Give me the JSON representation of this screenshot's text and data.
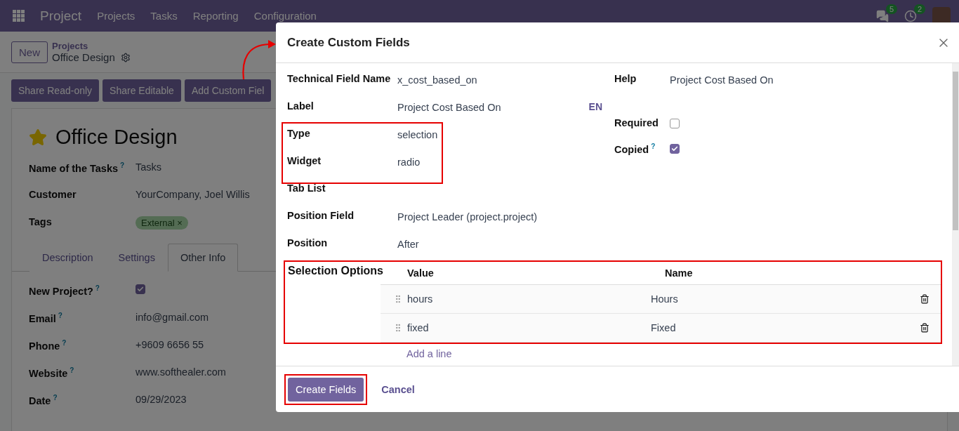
{
  "navbar": {
    "app_name": "Project",
    "menu": [
      "Projects",
      "Tasks",
      "Reporting",
      "Configuration"
    ],
    "messages_count": "5",
    "activities_count": "2"
  },
  "control_panel": {
    "new_button": "New",
    "breadcrumb_parent": "Projects",
    "breadcrumb_current": "Office Design"
  },
  "action_buttons": [
    "Share Read-only",
    "Share Editable",
    "Add Custom Fiel"
  ],
  "record": {
    "title": "Office Design",
    "starred": true,
    "fields": [
      {
        "label": "Name of the Tasks",
        "help_mark": "?",
        "value": "Tasks"
      },
      {
        "label": "Customer",
        "value": "YourCompany, Joel Willis"
      }
    ],
    "tags_label": "Tags",
    "tags": [
      {
        "label": "External",
        "remove": "×"
      }
    ],
    "tabs": [
      {
        "label": "Description",
        "selected": false
      },
      {
        "label": "Settings",
        "selected": false
      },
      {
        "label": "Other Info",
        "selected": true
      }
    ],
    "other_info": [
      {
        "kind": "checkbox",
        "label": "New Project?",
        "help_mark": "?",
        "checked": true
      },
      {
        "kind": "text",
        "label": "Email",
        "help_mark": "?",
        "value": "info@gmail.com"
      },
      {
        "kind": "text",
        "label": "Phone",
        "help_mark": "?",
        "value": "+9609 6656 55"
      },
      {
        "kind": "text",
        "label": "Website",
        "help_mark": "?",
        "value": "www.softhealer.com"
      },
      {
        "kind": "text",
        "label": "Date",
        "help_mark": "?",
        "value": "09/29/2023"
      }
    ]
  },
  "dialog": {
    "title": "Create Custom Fields",
    "fields": [
      {
        "label": "Technical Field Name",
        "value": "x_cost_based_on",
        "highlighted": false
      },
      {
        "label": "Label",
        "value": "Project Cost Based On",
        "language": "EN",
        "highlighted": false
      },
      {
        "label": "Type",
        "value": "selection",
        "highlighted": true
      },
      {
        "label": "Widget",
        "value": "radio",
        "highlighted": true
      },
      {
        "label": "Tab List",
        "highlighted": false
      },
      {
        "label": "Position Field",
        "value": "Project Leader (project.project)",
        "highlighted": false
      },
      {
        "label": "Position",
        "value": "After",
        "highlighted": false
      }
    ],
    "side_fields": [
      {
        "kind": "text",
        "label": "Help",
        "value": "Project Cost Based On"
      },
      {
        "kind": "checkbox",
        "label": "Required",
        "checked": false
      },
      {
        "kind": "checkbox",
        "label": "Copied",
        "help_mark": "?",
        "checked": true
      }
    ],
    "selection_options": {
      "label": "Selection Options",
      "highlighted": true,
      "columns": [
        "Value",
        "Name"
      ],
      "rows": [
        {
          "value": "hours",
          "name": "Hours"
        },
        {
          "value": "fixed",
          "name": "Fixed"
        }
      ],
      "add_line": "Add a line"
    },
    "buttons": [
      {
        "kind": "primary",
        "label": "Create Fields",
        "highlighted": true
      },
      {
        "kind": "secondary",
        "label": "Cancel",
        "highlighted": false
      }
    ]
  }
}
